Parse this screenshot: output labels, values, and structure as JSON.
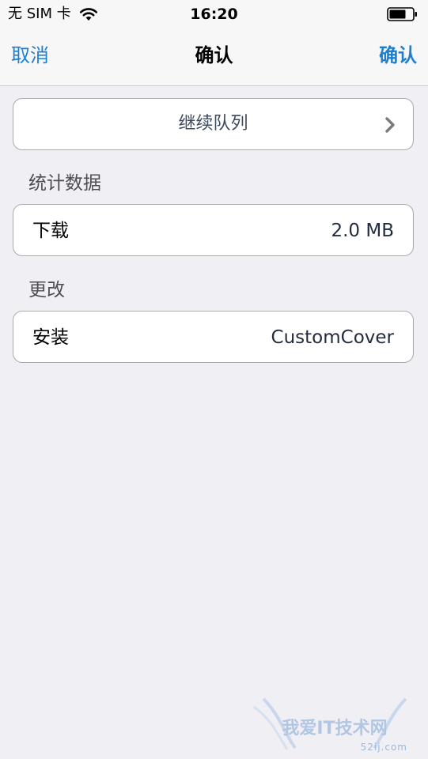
{
  "status_bar": {
    "carrier": "无 SIM 卡",
    "time": "16:20",
    "wifi_icon": "wifi-icon",
    "battery_icon": "battery-icon"
  },
  "nav": {
    "cancel_label": "取消",
    "title": "确认",
    "confirm_label": "确认"
  },
  "queue": {
    "label": "继续队列",
    "icon": "chevron-right-icon"
  },
  "stats": {
    "header": "统计数据",
    "download_label": "下载",
    "download_value": "2.0 MB"
  },
  "changes": {
    "header": "更改",
    "install_label": "安装",
    "install_value": "CustomCover"
  },
  "watermark": {
    "logo": "我爱IT技术网",
    "text": "52ij.com"
  },
  "colors": {
    "accent": "#1e7fcf",
    "background": "#efeff4",
    "cell_border": "#a9a9ae"
  }
}
